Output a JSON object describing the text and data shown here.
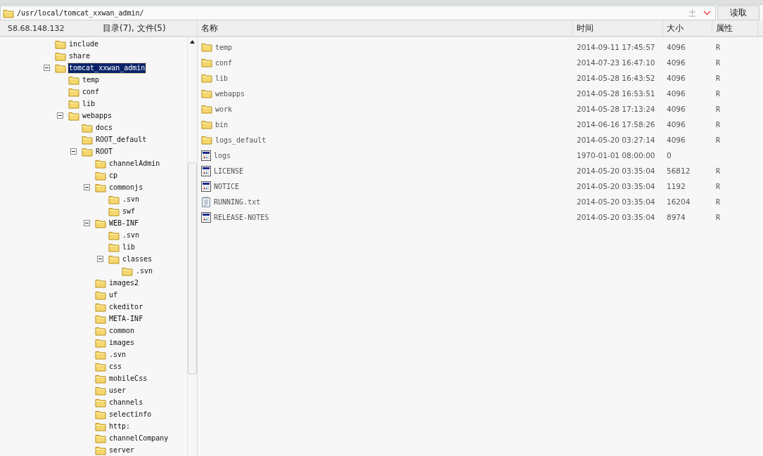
{
  "path_bar": {
    "value": "/usr/local/tomcat_xxwan_admin/"
  },
  "read_button": "读取",
  "left_header": {
    "host": "58.68.148.132",
    "summary": "目录(7), 文件(5)"
  },
  "tree": [
    {
      "name": "include",
      "selected": false
    },
    {
      "name": "share",
      "selected": false
    },
    {
      "name": "tomcat_xxwan_admin",
      "selected": true,
      "expanded": true,
      "children": [
        {
          "name": "temp",
          "selected": false
        },
        {
          "name": "conf",
          "selected": false
        },
        {
          "name": "lib",
          "selected": false
        },
        {
          "name": "webapps",
          "selected": false,
          "expanded": true,
          "children": [
            {
              "name": "docs",
              "selected": false
            },
            {
              "name": "ROOT_default",
              "selected": false
            },
            {
              "name": "ROOT",
              "selected": false,
              "expanded": true,
              "children": [
                {
                  "name": "channelAdmin",
                  "selected": false
                },
                {
                  "name": "cp",
                  "selected": false
                },
                {
                  "name": "commonjs",
                  "selected": false,
                  "expanded": true,
                  "children": [
                    {
                      "name": ".svn",
                      "selected": false
                    },
                    {
                      "name": "swf",
                      "selected": false
                    }
                  ]
                },
                {
                  "name": "WEB-INF",
                  "selected": false,
                  "expanded": true,
                  "children": [
                    {
                      "name": ".svn",
                      "selected": false
                    },
                    {
                      "name": "lib",
                      "selected": false
                    },
                    {
                      "name": "classes",
                      "selected": false,
                      "expanded": true,
                      "children": [
                        {
                          "name": ".svn",
                          "selected": false
                        }
                      ]
                    }
                  ]
                },
                {
                  "name": "images2",
                  "selected": false
                },
                {
                  "name": "uf",
                  "selected": false
                },
                {
                  "name": "ckeditor",
                  "selected": false
                },
                {
                  "name": "META-INF",
                  "selected": false
                },
                {
                  "name": "common",
                  "selected": false
                },
                {
                  "name": "images",
                  "selected": false
                },
                {
                  "name": ".svn",
                  "selected": false
                },
                {
                  "name": "css",
                  "selected": false
                },
                {
                  "name": "mobileCss",
                  "selected": false
                },
                {
                  "name": "user",
                  "selected": false
                },
                {
                  "name": "channels",
                  "selected": false
                },
                {
                  "name": "selectinfo",
                  "selected": false
                },
                {
                  "name": "http:",
                  "selected": false
                },
                {
                  "name": "channelCompany",
                  "selected": false
                },
                {
                  "name": "server",
                  "selected": false
                }
              ]
            }
          ]
        }
      ]
    }
  ],
  "files": {
    "columns": [
      "名称",
      "时间",
      "大小",
      "属性"
    ],
    "rows": [
      {
        "kind": "folder",
        "name": "temp",
        "time": "2014-09-11 17:45:57",
        "size": "4096",
        "attr": "R"
      },
      {
        "kind": "folder",
        "name": "conf",
        "time": "2014-07-23 16:47:10",
        "size": "4096",
        "attr": "R"
      },
      {
        "kind": "folder",
        "name": "lib",
        "time": "2014-05-28 16:43:52",
        "size": "4096",
        "attr": "R"
      },
      {
        "kind": "folder",
        "name": "webapps",
        "time": "2014-05-28 16:53:51",
        "size": "4096",
        "attr": "R"
      },
      {
        "kind": "folder",
        "name": "work",
        "time": "2014-05-28 17:13:24",
        "size": "4096",
        "attr": "R"
      },
      {
        "kind": "folder",
        "name": "bin",
        "time": "2014-06-16 17:58:26",
        "size": "4096",
        "attr": "R"
      },
      {
        "kind": "folder",
        "name": "logs_default",
        "time": "2014-05-20 03:27:14",
        "size": "4096",
        "attr": "R"
      },
      {
        "kind": "app",
        "name": "logs",
        "time": "1970-01-01 08:00:00",
        "size": "0"
      },
      {
        "kind": "app",
        "name": "LICENSE",
        "time": "2014-05-20 03:35:04",
        "size": "56812",
        "attr": "R"
      },
      {
        "kind": "app",
        "name": "NOTICE",
        "time": "2014-05-20 03:35:04",
        "size": "1192",
        "attr": "R"
      },
      {
        "kind": "text",
        "name": "RUNNING.txt",
        "time": "2014-05-20 03:35:04",
        "size": "16204",
        "attr": "R"
      },
      {
        "kind": "app",
        "name": "RELEASE-NOTES",
        "time": "2014-05-20 03:35:04",
        "size": "8974",
        "attr": "R"
      }
    ]
  }
}
